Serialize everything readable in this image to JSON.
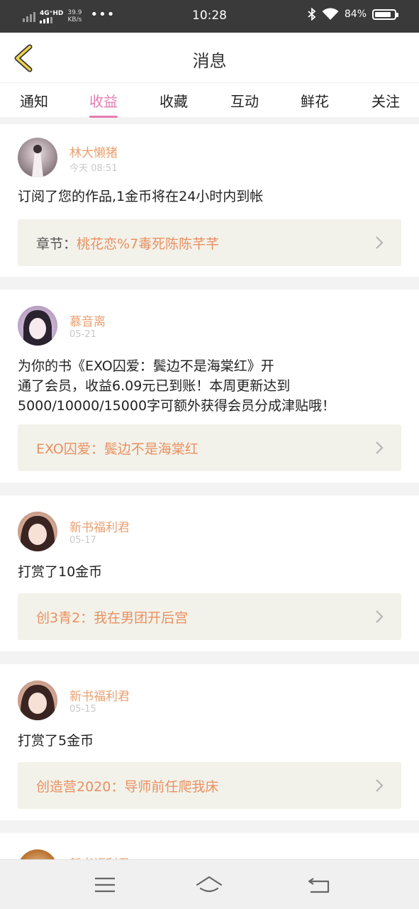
{
  "status_bar": {
    "network": "4G⁺HD",
    "speed_value": "39.9",
    "speed_unit": "KB/s",
    "dots": "•••",
    "time": "10:28",
    "battery_percent": "84%",
    "battery_level": 0.84
  },
  "header": {
    "title": "消息"
  },
  "tabs": [
    "通知",
    "收益",
    "收藏",
    "互动",
    "鲜花",
    "关注"
  ],
  "active_tab": "收益",
  "messages": [
    {
      "name": "林大懒猪",
      "date": "今天 08:51",
      "text": "订阅了您的作品,1金币将在24小时内到帐",
      "book_label": "章节：",
      "book_title": "桃花恋%7毒死陈陈芊芊"
    },
    {
      "name": "慕音离",
      "date": "05-21",
      "text_lines": [
        "为你的书《EXO囚爱：鬓边不是海棠红》开",
        "通了会员，收益6.09元已到账！本周更新达到",
        "5000/10000/15000字可额外获得会员分成津贴哦！"
      ],
      "book_title": "EXO囚爱：鬓边不是海棠红"
    },
    {
      "name": "新书福利君",
      "date": "05-17",
      "text": "打赏了10金币",
      "book_title": "创3青2：我在男团开后宫"
    },
    {
      "name": "新书福利君",
      "date": "05-15",
      "text": "打赏了5金币",
      "book_title": "创造营2020：导师前任爬我床"
    },
    {
      "name": "新书福利君",
      "date": ""
    }
  ],
  "colors": {
    "accent": "#e57cb0",
    "name": "#e8a070",
    "book_bg": "#f3f2ea"
  }
}
